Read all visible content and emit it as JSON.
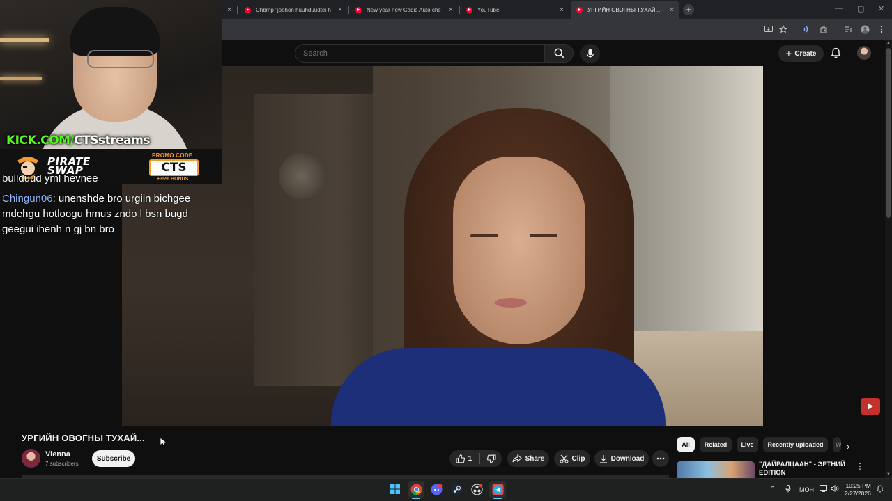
{
  "browser": {
    "tabs": [
      {
        "title": "Chbmp \"joohon huuhduudtei h",
        "close": "×"
      },
      {
        "title": "New year new Cadis Auto che",
        "close": "×"
      },
      {
        "title": "YouTube",
        "close": "×"
      },
      {
        "title": "УРГИЙН ОВОГНЫ ТУХАЙ... - Y",
        "close": "×"
      }
    ],
    "first_tab_close": "×",
    "new_tab": "+",
    "window_controls": [
      "—",
      "▢",
      "✕"
    ]
  },
  "youtube": {
    "search_placeholder": "Search",
    "create_label": "Create",
    "video": {
      "title": "УРГИЙН ОВОГНЫ ТУХАЙ...",
      "channel_name": "Vienna",
      "subscribers": "7 subscribers",
      "subscribe_label": "Subscribe",
      "likes": "1",
      "share_label": "Share",
      "clip_label": "Clip",
      "download_label": "Download"
    },
    "chips": [
      "All",
      "Related",
      "Live",
      "Recently uploaded",
      "W"
    ],
    "recommendation": {
      "title": "\"ДАЙРАЛЦААН\" - ЭРТНИЙ EDITION"
    }
  },
  "overlay": {
    "kick_prefix": "KICK.COM/",
    "kick_channel": "CTSstreams",
    "sponsor_line1": "PIRATE",
    "sponsor_line2": "SWAP",
    "promo_label": "PROMO CODE",
    "promo_code": "CTS",
    "promo_bonus": "+35% BONUS"
  },
  "chat": {
    "previous_fragment": "bullduud yml hevnee",
    "message": {
      "user": "Chingun06",
      "text": ": unenshde bro urgiin bichgee mdehgu hotloogu hmus zndo l bsn bugd geegui ihenh n gj bn bro"
    }
  },
  "taskbar": {
    "apps": [
      "windows-start",
      "chrome",
      "discord",
      "steam",
      "obs",
      "telegram"
    ],
    "tray_language": "МОН",
    "time": "10:25 PM",
    "date": "2/27/2026"
  },
  "colors": {
    "youtube_red": "#ff0033",
    "kick_green": "#53fc18",
    "promo_orange": "#f39b2a"
  }
}
